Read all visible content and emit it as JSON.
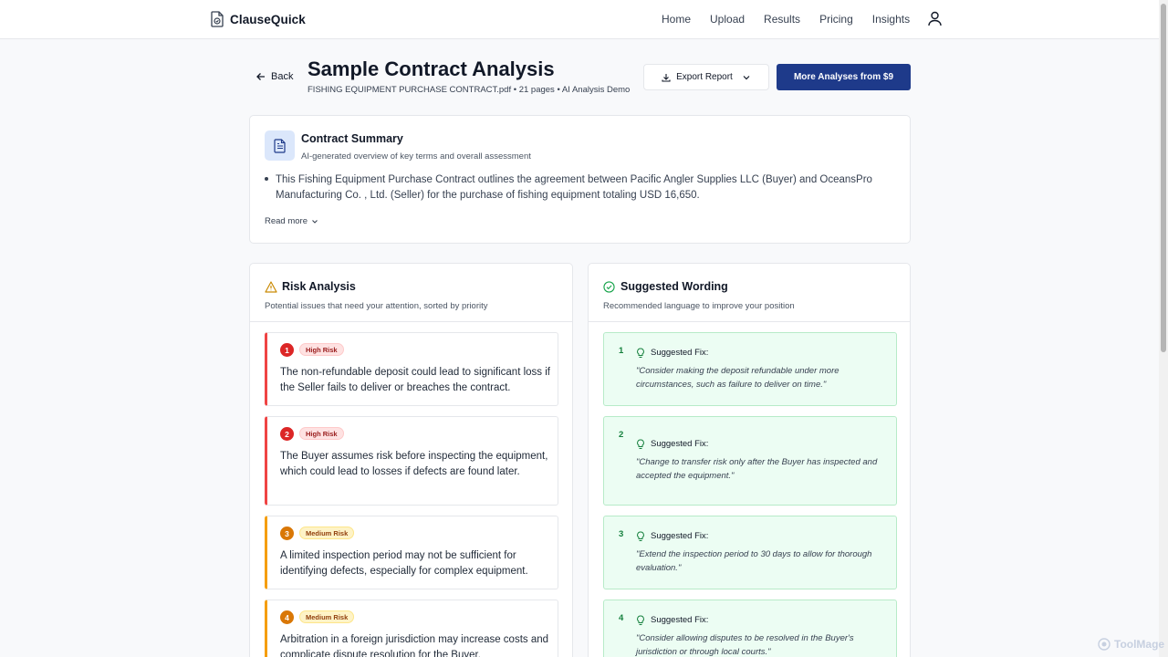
{
  "brand": {
    "name": "ClauseQuick"
  },
  "nav": {
    "items": [
      "Home",
      "Upload",
      "Results",
      "Pricing",
      "Insights"
    ]
  },
  "heading": {
    "back": "Back",
    "title": "Sample Contract Analysis",
    "meta": "FISHING EQUIPMENT PURCHASE CONTRACT.pdf • 21 pages • AI Analysis Demo",
    "export": "Export Report",
    "more": "More Analyses from $9"
  },
  "summary": {
    "title": "Contract Summary",
    "subtitle": "AI-generated overview of key terms and overall assessment",
    "text": "This Fishing Equipment Purchase Contract outlines the agreement between Pacific Angler Supplies LLC (Buyer) and OceansPro Manufacturing Co. , Ltd. (Seller) for the purchase of fishing equipment totaling USD 16,650.",
    "read_more": "Read more"
  },
  "risk": {
    "title": "Risk Analysis",
    "subtitle": "Potential issues that need your attention, sorted by priority",
    "items": [
      {
        "num": "1",
        "badge": "High Risk",
        "text": "The non-refundable deposit could lead to significant loss if the Seller fails to deliver or breaches the contract."
      },
      {
        "num": "2",
        "badge": "High Risk",
        "text": "The Buyer assumes risk before inspecting the equipment, which could lead to losses if defects are found later."
      },
      {
        "num": "3",
        "badge": "Medium Risk",
        "text": "A limited inspection period may not be sufficient for identifying defects, especially for complex equipment."
      },
      {
        "num": "4",
        "badge": "Medium Risk",
        "text": "Arbitration in a foreign jurisdiction may increase costs and complicate dispute resolution for the Buyer."
      }
    ]
  },
  "suggested": {
    "title": "Suggested Wording",
    "subtitle": "Recommended language to improve your position",
    "label": "Suggested Fix:",
    "items": [
      {
        "num": "1",
        "text": "\"Consider making the deposit refundable under more circumstances, such as failure to deliver on time.\""
      },
      {
        "num": "2",
        "text": "\"Change to transfer risk only after the Buyer has inspected and accepted the equipment.\""
      },
      {
        "num": "3",
        "text": "\"Extend the inspection period to 30 days to allow for thorough evaluation.\""
      },
      {
        "num": "4",
        "text": "\"Consider allowing disputes to be resolved in the Buyer's jurisdiction or through local courts.\""
      }
    ]
  },
  "watermark": "ToolMage",
  "colors": {
    "primary": "#1e3a8a",
    "high_risk": "#dc2626",
    "medium_risk": "#d97706",
    "success": "#15803d"
  }
}
